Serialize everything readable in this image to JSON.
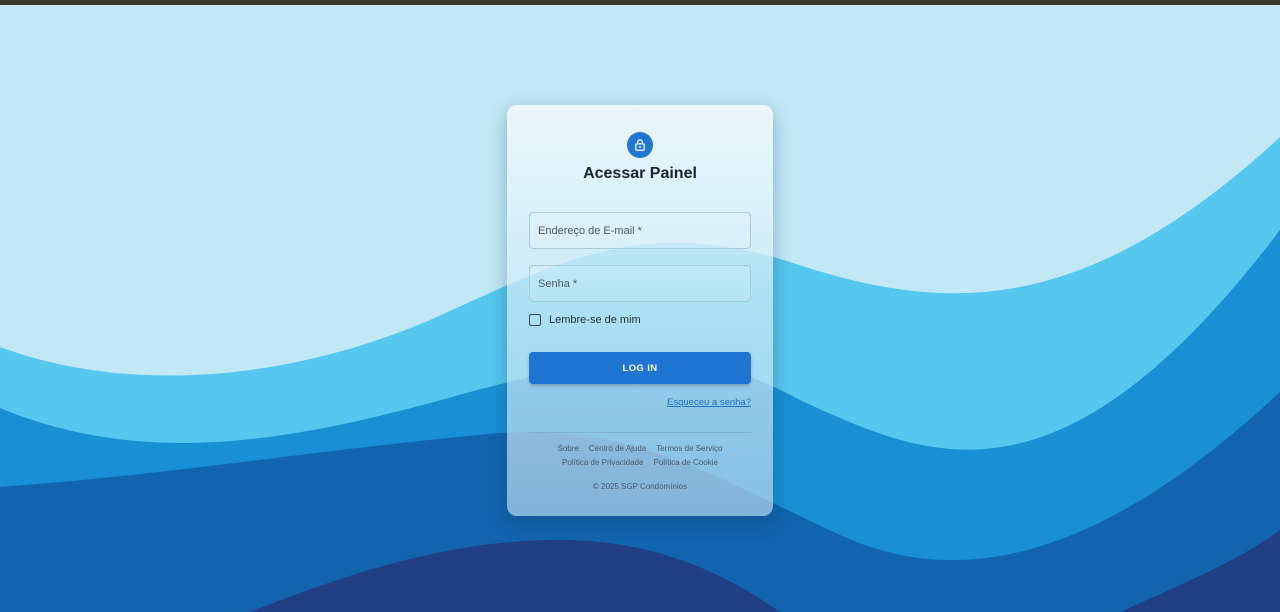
{
  "login": {
    "title": "Acessar Painel",
    "email_label": "Endereço de E-mail *",
    "password_label": "Senha *",
    "remember_label": "Lembre-se de mim",
    "login_button": "LOG IN",
    "forgot_link": "Esqueceu a senha?"
  },
  "footer": {
    "row1": [
      "Sobre",
      "Centro de Ajuda",
      "Termos de Serviço"
    ],
    "row2": [
      "Política de Privacidade",
      "Política de Cookie"
    ],
    "copyright": "© 2025 SGP Condomínios"
  },
  "icons": {
    "lock": "lock-icon"
  },
  "colors": {
    "accent": "#1f75d2",
    "background_sky": "#c2e8f6",
    "wave_light": "#56c7ee",
    "wave_mid": "#1890d3",
    "wave_deep": "#1164ad",
    "wave_darkest": "#213f85"
  }
}
